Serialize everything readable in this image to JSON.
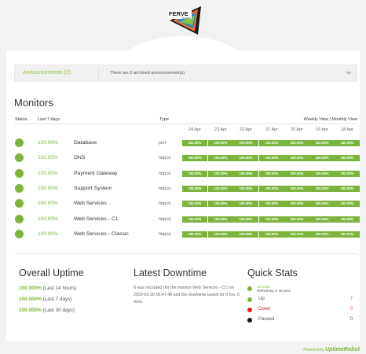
{
  "brand": {
    "logo_text": "FERVE",
    "logo_sub": "TICKETS"
  },
  "announcements": {
    "label": "Announcements (2)",
    "message": "There are 2 archived announcement(s)"
  },
  "monitors": {
    "title": "Monitors",
    "columns": {
      "status": "Status",
      "last7": "Last 7 days",
      "type": "Type"
    },
    "view_links": {
      "weekly": "Weekly View",
      "divider": "|",
      "monthly": "Monthly View"
    },
    "dates": [
      "24 Apr",
      "23 Apr",
      "22 Apr",
      "21 Apr",
      "20 Apr",
      "19 Apr",
      "18 Apr"
    ],
    "rows": [
      {
        "uptime": "100.00%",
        "name": "Database",
        "type": "port",
        "days": [
          "100.00%",
          "100.00%",
          "100.00%",
          "100.00%",
          "100.00%",
          "100.00%",
          "100.00%"
        ]
      },
      {
        "uptime": "100.00%",
        "name": "DNS",
        "type": "http(s)",
        "days": [
          "100.00%",
          "100.00%",
          "100.00%",
          "100.00%",
          "100.00%",
          "100.00%",
          "100.00%"
        ]
      },
      {
        "uptime": "100.00%",
        "name": "Payment Gateway",
        "type": "http(s)",
        "days": [
          "100.00%",
          "100.00%",
          "100.00%",
          "100.00%",
          "100.00%",
          "100.00%",
          "100.00%"
        ]
      },
      {
        "uptime": "100.00%",
        "name": "Support System",
        "type": "http(s)",
        "days": [
          "100.00%",
          "100.00%",
          "100.00%",
          "100.00%",
          "100.00%",
          "100.00%",
          "100.00%"
        ]
      },
      {
        "uptime": "100.00%",
        "name": "Web Services",
        "type": "http(s)",
        "days": [
          "100.00%",
          "100.00%",
          "100.00%",
          "100.00%",
          "100.00%",
          "100.00%",
          "100.00%"
        ]
      },
      {
        "uptime": "100.00%",
        "name": "Web Services - C1",
        "type": "http(s)",
        "days": [
          "100.00%",
          "100.00%",
          "100.00%",
          "100.00%",
          "100.00%",
          "100.00%",
          "100.00%"
        ]
      },
      {
        "uptime": "100.00%",
        "name": "Web Services - Classic",
        "type": "http(s)",
        "days": [
          "100.00%",
          "100.00%",
          "100.00%",
          "100.00%",
          "100.00%",
          "100.00%",
          "100.00%"
        ]
      }
    ]
  },
  "overall_uptime": {
    "title": "Overall Uptime",
    "items": [
      {
        "value": "100.000%",
        "period": "(Last 24 hours)"
      },
      {
        "value": "100.000%",
        "period": "(Last 7 days)"
      },
      {
        "value": "100.000%",
        "period": "(Last 30 days)"
      }
    ]
  },
  "latest_downtime": {
    "title": "Latest Downtime",
    "text": "It was recorded (for the monitor Web Services - C1) on 2020-03-30 05:47:48 and the downtime lasted for 0 hrs, 0 mins."
  },
  "quick_stats": {
    "title": "Quick Stats",
    "all_clear": "All Clear",
    "refresh": "Refreshing in 46 secs",
    "items": [
      {
        "label": "Up",
        "value": "7",
        "color": "#7bb53b",
        "value_color": "#e05a5a"
      },
      {
        "label": "Down",
        "value": "0",
        "color": "#e02020",
        "value_color": "#e05a5a"
      },
      {
        "label": "Paused",
        "value": "0",
        "color": "#111111",
        "value_color": "#555555"
      }
    ]
  },
  "footer": {
    "powered_by": "Powered by",
    "brand": "UptimeRobot"
  },
  "colors": {
    "accent": "#7bb53b",
    "panel": "#ffffff",
    "page": "#f2f2f2"
  }
}
